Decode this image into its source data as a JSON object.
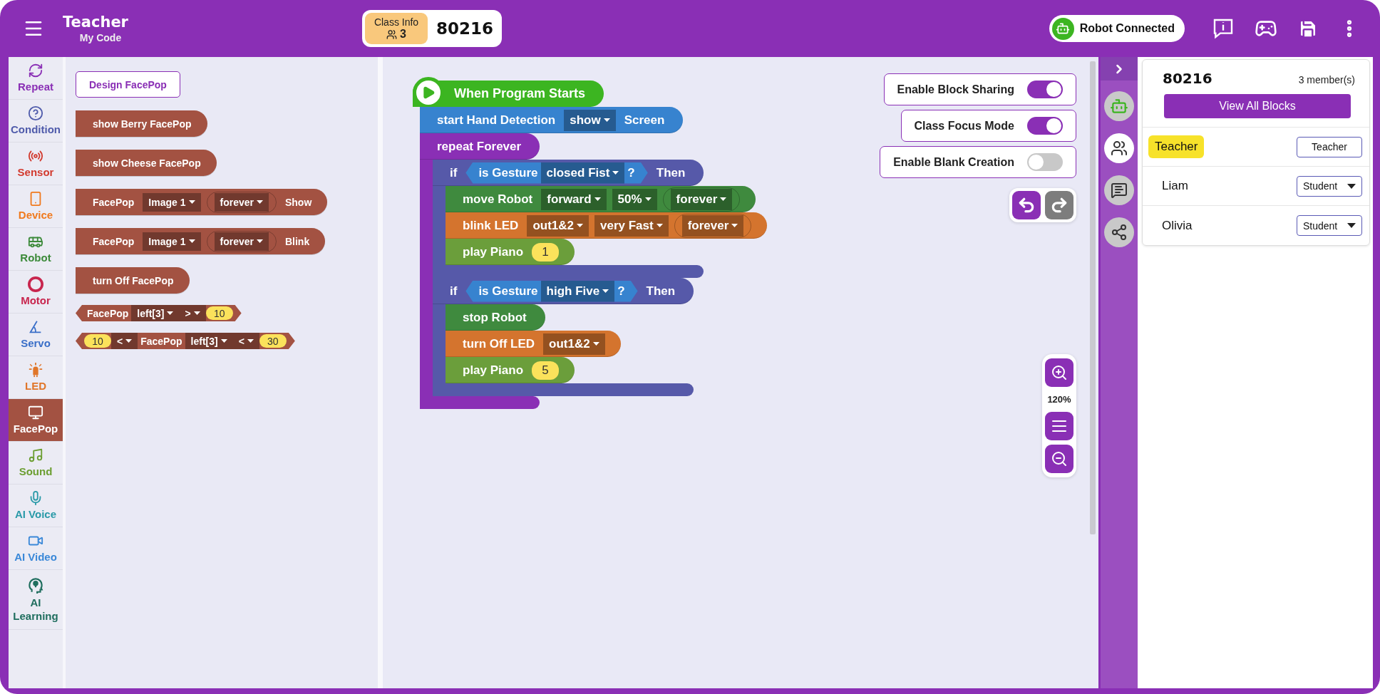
{
  "header": {
    "title": "Teacher",
    "subtitle": "My Code",
    "class_info": {
      "label": "Class Info",
      "count": "3",
      "code": "80216"
    },
    "robot_status": "Robot Connected"
  },
  "categories": [
    {
      "kind": "repeat",
      "label": "Repeat",
      "color": "#8a2fb5",
      "selected": false
    },
    {
      "kind": "condition",
      "label": "Condition",
      "color": "#4f5bab",
      "selected": false
    },
    {
      "kind": "sensor",
      "label": "Sensor",
      "color": "#d23a2e",
      "selected": false
    },
    {
      "kind": "device",
      "label": "Device",
      "color": "#f07a1e",
      "selected": false
    },
    {
      "kind": "robot",
      "label": "Robot",
      "color": "#3c8a3a",
      "selected": false
    },
    {
      "kind": "motor",
      "label": "Motor",
      "color": "#c8264e",
      "selected": false
    },
    {
      "kind": "servo",
      "label": "Servo",
      "color": "#3a6fc8",
      "selected": false
    },
    {
      "kind": "led",
      "label": "LED",
      "color": "#e0762a",
      "selected": false
    },
    {
      "kind": "facepop",
      "label": "FacePop",
      "color": "#a35242",
      "selected": true
    },
    {
      "kind": "sound",
      "label": "Sound",
      "color": "#6c9e32",
      "selected": false
    },
    {
      "kind": "voice",
      "label": "AI Voice",
      "color": "#2a9aa8",
      "selected": false
    },
    {
      "kind": "video",
      "label": "AI Video",
      "color": "#3a88d8",
      "selected": false
    },
    {
      "kind": "learning",
      "label": "AI Learning",
      "color": "#1f6e5e",
      "selected": false
    }
  ],
  "palette": {
    "design_button": "Design FacePop",
    "blocks": [
      {
        "kind": "stack",
        "parts": [
          {
            "kind": "text",
            "text": "show Berry FacePop"
          }
        ]
      },
      {
        "kind": "stack",
        "parts": [
          {
            "kind": "text",
            "text": "show Cheese FacePop"
          }
        ]
      },
      {
        "kind": "stack",
        "parts": [
          {
            "kind": "text",
            "text": "FacePop"
          },
          {
            "kind": "dropdown",
            "text": "Image 1"
          },
          {
            "kind": "round",
            "text": "forever"
          },
          {
            "kind": "text",
            "text": "Show"
          }
        ]
      },
      {
        "kind": "stack",
        "parts": [
          {
            "kind": "text",
            "text": "FacePop"
          },
          {
            "kind": "dropdown",
            "text": "Image 1"
          },
          {
            "kind": "round",
            "text": "forever"
          },
          {
            "kind": "text",
            "text": "Blink"
          }
        ]
      },
      {
        "kind": "stack",
        "parts": [
          {
            "kind": "text",
            "text": "turn Off FacePop"
          }
        ]
      },
      {
        "kind": "reporter",
        "parts": [
          {
            "kind": "text",
            "text": "FacePop"
          },
          {
            "kind": "dropdown",
            "text": "left[3]"
          },
          {
            "kind": "dropdown",
            "text": ">"
          },
          {
            "kind": "number",
            "text": "10"
          }
        ]
      },
      {
        "kind": "reporter",
        "parts": [
          {
            "kind": "number",
            "text": "10"
          },
          {
            "kind": "dropdown",
            "text": "<"
          },
          {
            "kind": "text",
            "text": "FacePop"
          },
          {
            "kind": "dropdown",
            "text": "left[3]"
          },
          {
            "kind": "dropdown",
            "text": "<"
          },
          {
            "kind": "number",
            "text": "30"
          }
        ]
      }
    ]
  },
  "workspace": {
    "blocks": [
      {
        "kind": "hat",
        "color": "#3cb521",
        "parts": [
          {
            "kind": "text",
            "text": "When Program Starts"
          }
        ]
      },
      {
        "kind": "stack",
        "color": "#3783cf",
        "parts": [
          {
            "kind": "text",
            "text": "start Hand Detection"
          },
          {
            "kind": "dropdown",
            "text": "show"
          },
          {
            "kind": "text",
            "text": "Screen"
          }
        ]
      },
      {
        "kind": "loop",
        "color": "#8a2fb5",
        "parts": [
          {
            "kind": "text",
            "text": "repeat Forever"
          }
        ],
        "children": [
          {
            "kind": "loop",
            "color": "#5659a9",
            "parts": [
              {
                "kind": "text",
                "text": "if"
              },
              {
                "kind": "condition",
                "color": "#3783cf",
                "parts": [
                  {
                    "kind": "text",
                    "text": "is Gesture"
                  },
                  {
                    "kind": "dropdown",
                    "text": "closed Fist"
                  },
                  {
                    "kind": "text",
                    "text": "?"
                  }
                ]
              },
              {
                "kind": "text",
                "text": "Then"
              }
            ],
            "children": [
              {
                "kind": "stack",
                "color": "#3f8a3e",
                "parts": [
                  {
                    "kind": "text",
                    "text": "move Robot"
                  },
                  {
                    "kind": "dropdown",
                    "text": "forward"
                  },
                  {
                    "kind": "dropdown",
                    "text": "50%"
                  },
                  {
                    "kind": "round",
                    "text": "forever"
                  }
                ]
              },
              {
                "kind": "stack",
                "color": "#d4742e",
                "parts": [
                  {
                    "kind": "text",
                    "text": "blink LED"
                  },
                  {
                    "kind": "dropdown",
                    "text": "out1&2"
                  },
                  {
                    "kind": "dropdown",
                    "text": "very Fast"
                  },
                  {
                    "kind": "round",
                    "text": "forever"
                  }
                ]
              },
              {
                "kind": "stack",
                "color": "#6b9e3b",
                "parts": [
                  {
                    "kind": "text",
                    "text": "play Piano"
                  },
                  {
                    "kind": "number",
                    "text": "1"
                  }
                ]
              }
            ]
          },
          {
            "kind": "loop",
            "color": "#5659a9",
            "parts": [
              {
                "kind": "text",
                "text": "if"
              },
              {
                "kind": "condition",
                "color": "#3783cf",
                "parts": [
                  {
                    "kind": "text",
                    "text": "is Gesture"
                  },
                  {
                    "kind": "dropdown",
                    "text": "high Five"
                  },
                  {
                    "kind": "text",
                    "text": "?"
                  }
                ]
              },
              {
                "kind": "text",
                "text": "Then"
              }
            ],
            "children": [
              {
                "kind": "stack",
                "color": "#3f8a3e",
                "parts": [
                  {
                    "kind": "text",
                    "text": "stop Robot"
                  }
                ]
              },
              {
                "kind": "stack",
                "color": "#d4742e",
                "parts": [
                  {
                    "kind": "text",
                    "text": "turn Off LED"
                  },
                  {
                    "kind": "dropdown",
                    "text": "out1&2"
                  }
                ]
              },
              {
                "kind": "stack",
                "color": "#6b9e3b",
                "parts": [
                  {
                    "kind": "text",
                    "text": "play Piano"
                  },
                  {
                    "kind": "number",
                    "text": "5"
                  }
                ]
              }
            ]
          }
        ]
      }
    ],
    "settings": [
      {
        "label": "Enable Block Sharing",
        "on": true
      },
      {
        "label": "Class Focus Mode",
        "on": true
      },
      {
        "label": "Enable Blank Creation",
        "on": false
      }
    ],
    "zoom": "120%"
  },
  "side_tabs": [
    {
      "kind": "robot",
      "selected": false
    },
    {
      "kind": "members",
      "selected": true
    },
    {
      "kind": "chat",
      "selected": false
    },
    {
      "kind": "share",
      "selected": false
    }
  ],
  "members_panel": {
    "code": "80216",
    "count": "3 member(s)",
    "button": "View All Blocks",
    "members": [
      {
        "name": "Teacher",
        "role": "Teacher",
        "kind": "fixed",
        "highlighted": true
      },
      {
        "name": "Liam",
        "role": "Student",
        "kind": "select",
        "highlighted": false
      },
      {
        "name": "Olivia",
        "role": "Student",
        "kind": "select",
        "highlighted": false
      }
    ]
  }
}
